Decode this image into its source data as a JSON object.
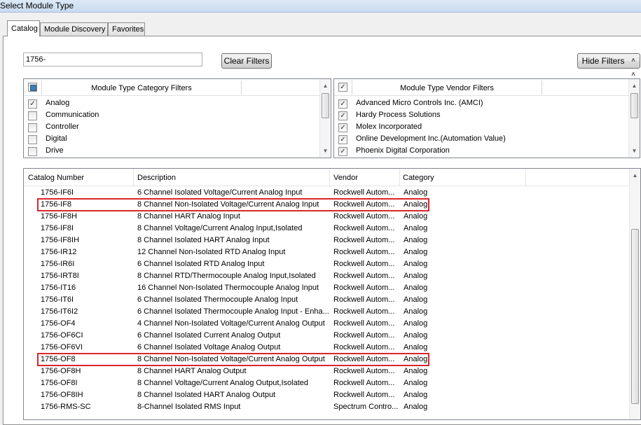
{
  "window": {
    "title": "Select Module Type"
  },
  "tabs": [
    {
      "label": "Catalog",
      "active": true
    },
    {
      "label": "Module Discovery",
      "active": false
    },
    {
      "label": "Favorites",
      "active": false
    }
  ],
  "filter": {
    "value": "1756-",
    "placeholder": ""
  },
  "buttons": {
    "clear_filters": "Clear Filters",
    "hide_filters": "Hide Filters",
    "hide_filters_icon": "double-chevron-up"
  },
  "category_filters": {
    "header": "Module Type Category Filters",
    "header_checkbox_state": "partial",
    "items": [
      {
        "label": "Analog",
        "checked": true
      },
      {
        "label": "Communication",
        "checked": false
      },
      {
        "label": "Controller",
        "checked": false
      },
      {
        "label": "Digital",
        "checked": false
      },
      {
        "label": "Drive",
        "checked": false
      }
    ]
  },
  "vendor_filters": {
    "header": "Module Type Vendor Filters",
    "header_checkbox_state": "checked",
    "items": [
      {
        "label": "Advanced Micro Controls Inc. (AMCI)",
        "checked": true
      },
      {
        "label": "Hardy Process Solutions",
        "checked": true
      },
      {
        "label": "Molex Incorporated",
        "checked": true
      },
      {
        "label": "Online Development Inc.(Automation Value)",
        "checked": true
      },
      {
        "label": "Phoenix Digital Corporation",
        "checked": true
      }
    ]
  },
  "catalog": {
    "columns": [
      "Catalog Number",
      "Description",
      "Vendor",
      "Category"
    ],
    "rows": [
      {
        "number": "1756-IF6I",
        "description": "6 Channel Isolated Voltage/Current Analog Input",
        "vendor": "Rockwell Autom...",
        "category": "Analog",
        "highlighted": false
      },
      {
        "number": "1756-IF8",
        "description": "8 Channel Non-Isolated Voltage/Current Analog Input",
        "vendor": "Rockwell Autom...",
        "category": "Analog",
        "highlighted": true
      },
      {
        "number": "1756-IF8H",
        "description": "8 Channel HART Analog Input",
        "vendor": "Rockwell Autom...",
        "category": "Analog",
        "highlighted": false
      },
      {
        "number": "1756-IF8I",
        "description": "8 Channel Voltage/Current Analog Input,Isolated",
        "vendor": "Rockwell Autom...",
        "category": "Analog",
        "highlighted": false
      },
      {
        "number": "1756-IF8IH",
        "description": "8 Channel Isolated HART Analog Input",
        "vendor": "Rockwell Autom...",
        "category": "Analog",
        "highlighted": false
      },
      {
        "number": "1756-IR12",
        "description": "12 Channel Non-Isolated RTD Analog Input",
        "vendor": "Rockwell Autom...",
        "category": "Analog",
        "highlighted": false
      },
      {
        "number": "1756-IR6I",
        "description": "6 Channel Isolated RTD Analog Input",
        "vendor": "Rockwell Autom...",
        "category": "Analog",
        "highlighted": false
      },
      {
        "number": "1756-IRT8I",
        "description": "8 Channel RTD/Thermocouple Analog Input,Isolated",
        "vendor": "Rockwell Autom...",
        "category": "Analog",
        "highlighted": false
      },
      {
        "number": "1756-IT16",
        "description": "16 Channel Non-Isolated Thermocouple Analog Input",
        "vendor": "Rockwell Autom...",
        "category": "Analog",
        "highlighted": false
      },
      {
        "number": "1756-IT6I",
        "description": "6 Channel Isolated Thermocouple Analog Input",
        "vendor": "Rockwell Autom...",
        "category": "Analog",
        "highlighted": false
      },
      {
        "number": "1756-IT6I2",
        "description": "6 Channel Isolated Thermocouple Analog Input - Enha...",
        "vendor": "Rockwell Autom...",
        "category": "Analog",
        "highlighted": false
      },
      {
        "number": "1756-OF4",
        "description": "4 Channel Non-Isolated Voltage/Current Analog Output",
        "vendor": "Rockwell Autom...",
        "category": "Analog",
        "highlighted": false
      },
      {
        "number": "1756-OF6CI",
        "description": "6 Channel Isolated Current Analog Output",
        "vendor": "Rockwell Autom...",
        "category": "Analog",
        "highlighted": false
      },
      {
        "number": "1756-OF6VI",
        "description": "6 Channel Isolated Voltage Analog Output",
        "vendor": "Rockwell Autom...",
        "category": "Analog",
        "highlighted": false
      },
      {
        "number": "1756-OF8",
        "description": "8 Channel Non-Isolated Voltage/Current Analog Output",
        "vendor": "Rockwell Autom...",
        "category": "Analog",
        "highlighted": true
      },
      {
        "number": "1756-OF8H",
        "description": "8 Channel HART Analog Output",
        "vendor": "Rockwell Autom...",
        "category": "Analog",
        "highlighted": false
      },
      {
        "number": "1756-OF8I",
        "description": "8 Channel Voltage/Current Analog Output,Isolated",
        "vendor": "Rockwell Autom...",
        "category": "Analog",
        "highlighted": false
      },
      {
        "number": "1756-OF8IH",
        "description": "8 Channel Isolated HART Analog Output",
        "vendor": "Rockwell Autom...",
        "category": "Analog",
        "highlighted": false
      },
      {
        "number": "1756-RMS-SC",
        "description": "8-Channel Isolated RMS Input",
        "vendor": "Spectrum Contro...",
        "category": "Analog",
        "highlighted": false
      }
    ]
  },
  "colors": {
    "highlight": "#d9262b",
    "checkbox_partial": "#3c7fb1"
  }
}
